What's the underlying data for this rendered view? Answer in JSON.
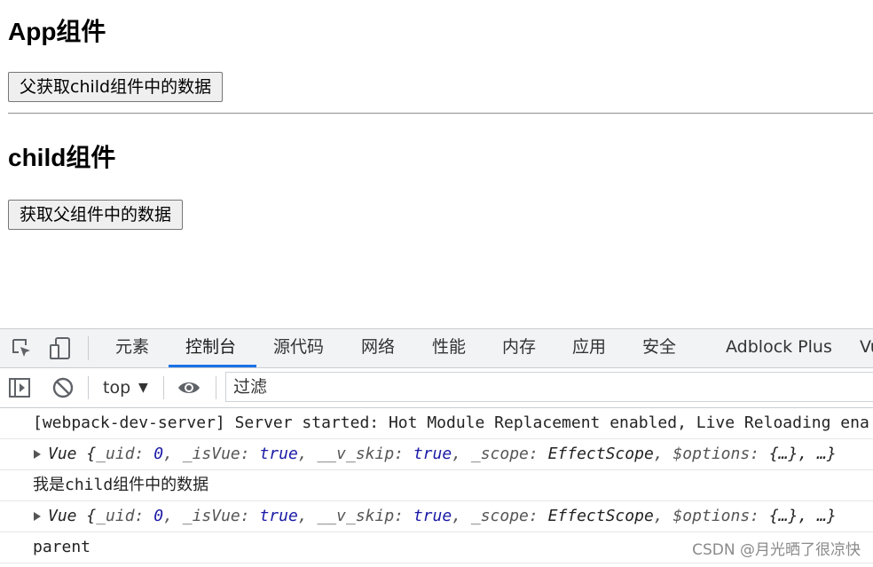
{
  "app": {
    "title": "App组件",
    "button_label": "父获取child组件中的数据"
  },
  "child": {
    "title": "child组件",
    "button_label": "获取父组件中的数据"
  },
  "devtools": {
    "tabs": [
      {
        "label": "元素"
      },
      {
        "label": "控制台"
      },
      {
        "label": "源代码"
      },
      {
        "label": "网络"
      },
      {
        "label": "性能"
      },
      {
        "label": "内存"
      },
      {
        "label": "应用"
      },
      {
        "label": "安全"
      },
      {
        "label": "Adblock Plus"
      },
      {
        "label": "Vu"
      }
    ],
    "active_tab": "控制台",
    "context": "top",
    "filter_placeholder": "过滤",
    "console": {
      "line1": "[webpack-dev-server] Server started: Hot Module Replacement enabled, Live Reloading ena",
      "obj": {
        "prefix": "Vue {",
        "uid_key": "_uid: ",
        "uid_val": "0",
        "isvue_key": ", _isVue: ",
        "isvue_val": "true",
        "skip_key": ", __v_skip: ",
        "skip_val": "true",
        "scope_key": ", _scope: ",
        "scope_val": "EffectScope",
        "options_key": ", $options: ",
        "options_val": "{…}",
        "suffix": ", …}"
      },
      "line3_prefix": "我是",
      "line3_code": "child",
      "line3_suffix": "组件中的数据",
      "line5": "parent"
    },
    "accent_color": "#1a73e8"
  },
  "watermark": "CSDN @月光晒了很凉快"
}
